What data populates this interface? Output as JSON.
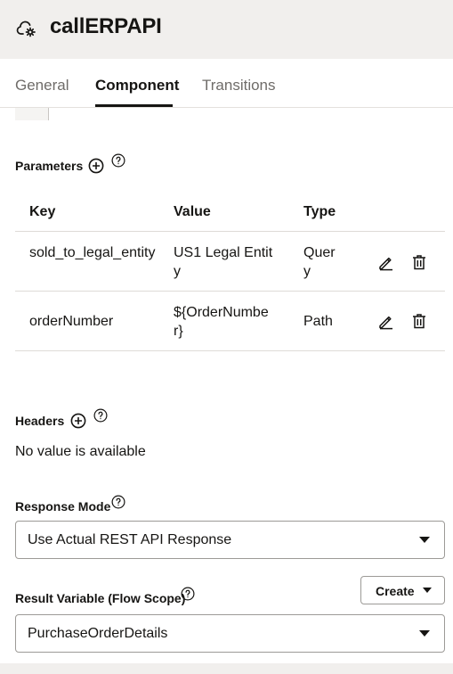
{
  "header": {
    "title": "callERPAPI",
    "icon": "cloud-gear-icon"
  },
  "tabs": [
    {
      "label": "General",
      "active": false
    },
    {
      "label": "Component",
      "active": true
    },
    {
      "label": "Transitions",
      "active": false
    }
  ],
  "parameters": {
    "label": "Parameters",
    "columns": [
      "Key",
      "Value",
      "Type"
    ],
    "rows": [
      {
        "key": "sold_to_legal_entity",
        "value": "US1 Legal Entity",
        "type": "Query"
      },
      {
        "key": "orderNumber",
        "value": "${OrderNumber}",
        "type": "Path"
      }
    ]
  },
  "headers": {
    "label": "Headers",
    "empty_text": "No value is available"
  },
  "response_mode": {
    "label": "Response Mode",
    "selected": "Use Actual REST API Response"
  },
  "result_variable": {
    "label": "Result Variable (Flow Scope)",
    "selected": "PurchaseOrderDetails",
    "create_label": "Create"
  }
}
